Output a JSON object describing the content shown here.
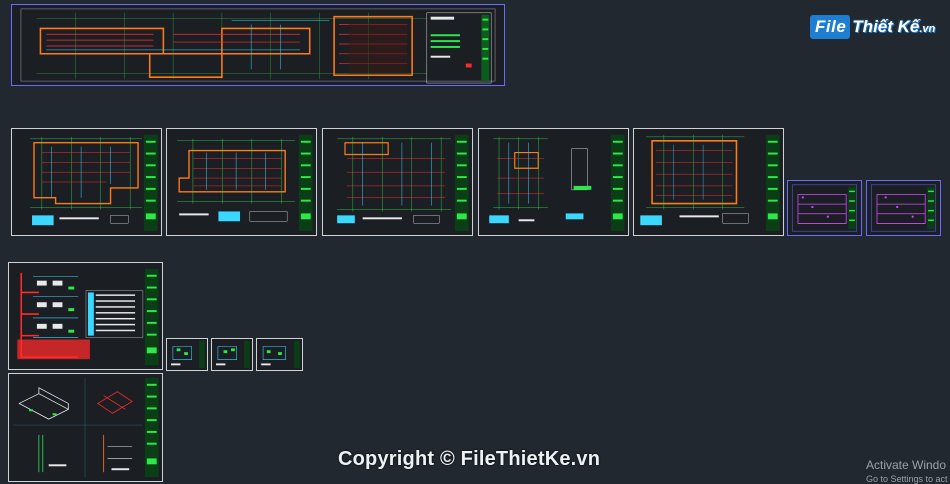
{
  "logo": {
    "brand": "File",
    "rest": "Thiết Kế",
    "suffix": ".vn"
  },
  "watermark": {
    "copyright": "Copyright © FileThietKe.vn"
  },
  "activation": {
    "title": "Activate Windo",
    "subtitle": "Go to Settings to act"
  },
  "colors": {
    "canvas": "#212830",
    "sheet_border": "#cfd3d6",
    "selected_border": "#6a6cff",
    "wall_orange": "#ff7a1a",
    "pipe_red": "#ff2a2a",
    "cad_green": "#2ee84a",
    "cad_cyan": "#3ad7ff",
    "cad_magenta": "#d24cff",
    "text_white": "#e8e8e8"
  },
  "sheets": [
    {
      "id": "site-plan",
      "kind": "plan-long",
      "selected": true
    },
    {
      "id": "floor-plan-1",
      "kind": "plan",
      "selected": false
    },
    {
      "id": "floor-plan-2",
      "kind": "plan",
      "selected": false
    },
    {
      "id": "floor-plan-3",
      "kind": "plan",
      "selected": false
    },
    {
      "id": "floor-plan-4",
      "kind": "plan-small",
      "selected": false
    },
    {
      "id": "floor-plan-5",
      "kind": "plan-box",
      "selected": false
    },
    {
      "id": "section-sheet-1",
      "kind": "magenta",
      "selected": true
    },
    {
      "id": "section-sheet-2",
      "kind": "magenta",
      "selected": true
    },
    {
      "id": "riser-diagram",
      "kind": "riser",
      "selected": false
    },
    {
      "id": "detail-thumb-1",
      "kind": "thumb",
      "selected": false
    },
    {
      "id": "detail-thumb-2",
      "kind": "thumb",
      "selected": false
    },
    {
      "id": "detail-thumb-3",
      "kind": "thumb",
      "selected": false
    },
    {
      "id": "isometric-details",
      "kind": "iso",
      "selected": false
    }
  ]
}
